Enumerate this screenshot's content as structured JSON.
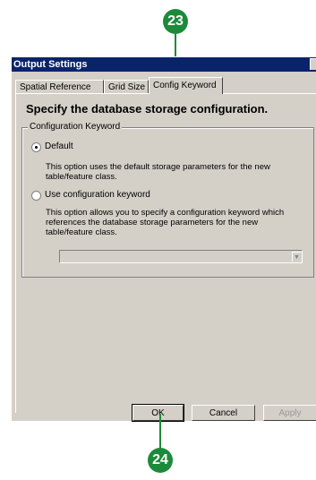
{
  "callouts": {
    "top": "23",
    "bottom": "24"
  },
  "window": {
    "title": "Output Settings"
  },
  "tabs": [
    {
      "label": "Spatial Reference"
    },
    {
      "label": "Grid Size"
    },
    {
      "label": "Config Keyword",
      "active": true
    }
  ],
  "heading": "Specify the database storage configuration.",
  "group": {
    "legend": "Configuration Keyword",
    "option_default": {
      "label": "Default",
      "selected": true,
      "description": "This option uses the default storage parameters for the new table/feature class."
    },
    "option_keyword": {
      "label": "Use configuration keyword",
      "selected": false,
      "description": "This option allows you to specify a configuration keyword which references the database storage parameters for the new table/feature class."
    },
    "keyword_value": ""
  },
  "buttons": {
    "ok": "OK",
    "cancel": "Cancel",
    "apply": "Apply"
  },
  "colors": {
    "callout": "#1d8a3a",
    "titlebar": "#0a246a",
    "dialog": "#d4d0c8"
  },
  "icons": {
    "combo_arrow": "chevron-down-icon"
  }
}
